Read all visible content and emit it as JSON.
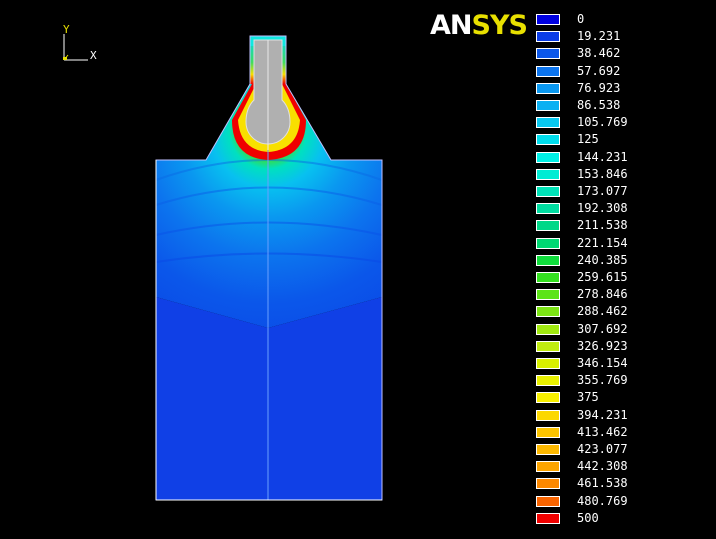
{
  "logo": {
    "part1": "AN",
    "part2": "SYS"
  },
  "triad": {
    "y": "Y",
    "x": "X"
  },
  "legend": [
    {
      "label": "0",
      "color": "#0000e0"
    },
    {
      "label": "19.231",
      "color": "#0a3ce6"
    },
    {
      "label": "38.462",
      "color": "#0b57ea"
    },
    {
      "label": "57.692",
      "color": "#0c74ee"
    },
    {
      "label": "76.923",
      "color": "#0a98f0"
    },
    {
      "label": "86.538",
      "color": "#0ab0f2"
    },
    {
      "label": "105.769",
      "color": "#08c8f0"
    },
    {
      "label": "125",
      "color": "#00dcec"
    },
    {
      "label": "144.231",
      "color": "#00f0e6"
    },
    {
      "label": "153.846",
      "color": "#00ecd4"
    },
    {
      "label": "173.077",
      "color": "#00e2b8"
    },
    {
      "label": "192.308",
      "color": "#00dca0"
    },
    {
      "label": "211.538",
      "color": "#00d888"
    },
    {
      "label": "221.154",
      "color": "#00d872"
    },
    {
      "label": "240.385",
      "color": "#10dc3c"
    },
    {
      "label": "259.615",
      "color": "#34e020"
    },
    {
      "label": "278.846",
      "color": "#5ce418"
    },
    {
      "label": "288.462",
      "color": "#7ce414"
    },
    {
      "label": "307.692",
      "color": "#a0e810"
    },
    {
      "label": "326.923",
      "color": "#c0ec10"
    },
    {
      "label": "346.154",
      "color": "#d8f000"
    },
    {
      "label": "355.769",
      "color": "#e8f000"
    },
    {
      "label": "375",
      "color": "#f8f000"
    },
    {
      "label": "394.231",
      "color": "#fcd800"
    },
    {
      "label": "413.462",
      "color": "#fcc400"
    },
    {
      "label": "423.077",
      "color": "#fcb800"
    },
    {
      "label": "442.308",
      "color": "#fca400"
    },
    {
      "label": "461.538",
      "color": "#fc8800"
    },
    {
      "label": "480.769",
      "color": "#f86400"
    },
    {
      "label": "500",
      "color": "#f00000"
    }
  ]
}
